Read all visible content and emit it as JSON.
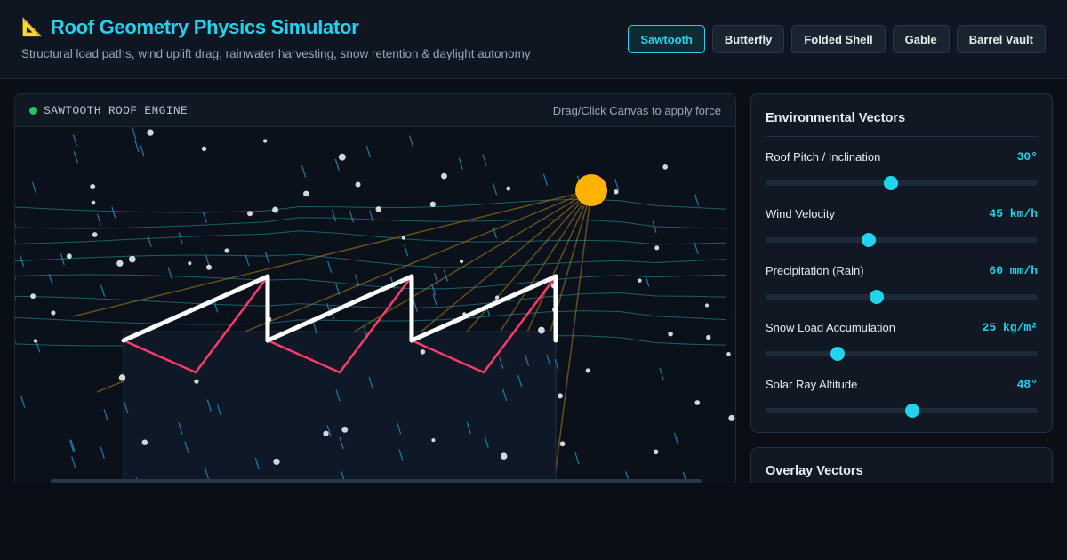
{
  "header": {
    "icon": "triangular-ruler-icon",
    "icon_glyph": "📐",
    "title": "Roof Geometry Physics Simulator",
    "subtitle": "Structural load paths, wind uplift drag, rainwater harvesting, snow retention & daylight autonomy"
  },
  "roof_tabs": [
    {
      "label": "Sawtooth",
      "active": true
    },
    {
      "label": "Butterfly",
      "active": false
    },
    {
      "label": "Folded Shell",
      "active": false
    },
    {
      "label": "Gable",
      "active": false
    },
    {
      "label": "Barrel Vault",
      "active": false
    }
  ],
  "canvas": {
    "engine_label": "SAWTOOTH ROOF ENGINE",
    "status_color": "#22c55e",
    "hint": "Drag/Click Canvas to apply force"
  },
  "environment": {
    "title": "Environmental Vectors",
    "sliders": [
      {
        "label": "Roof Pitch / Inclination",
        "value": "30°",
        "fraction": 0.46
      },
      {
        "label": "Wind Velocity",
        "value": "45 km/h",
        "fraction": 0.38
      },
      {
        "label": "Precipitation (Rain)",
        "value": "60 mm/h",
        "fraction": 0.408
      },
      {
        "label": "Snow Load Accumulation",
        "value": "25 kg/m²",
        "fraction": 0.265
      },
      {
        "label": "Solar Ray Altitude",
        "value": "48°",
        "fraction": 0.54
      }
    ]
  },
  "overlay": {
    "title": "Overlay Vectors"
  },
  "colors": {
    "accent": "#22d3ee",
    "roof_surface": "#ffffff",
    "load_path": "#ff3b6b",
    "sun": "#ffb300",
    "wind_streamline": "#1f7a84",
    "rain": "#1e8fbf",
    "solar_ray": "#8a6a1e"
  }
}
